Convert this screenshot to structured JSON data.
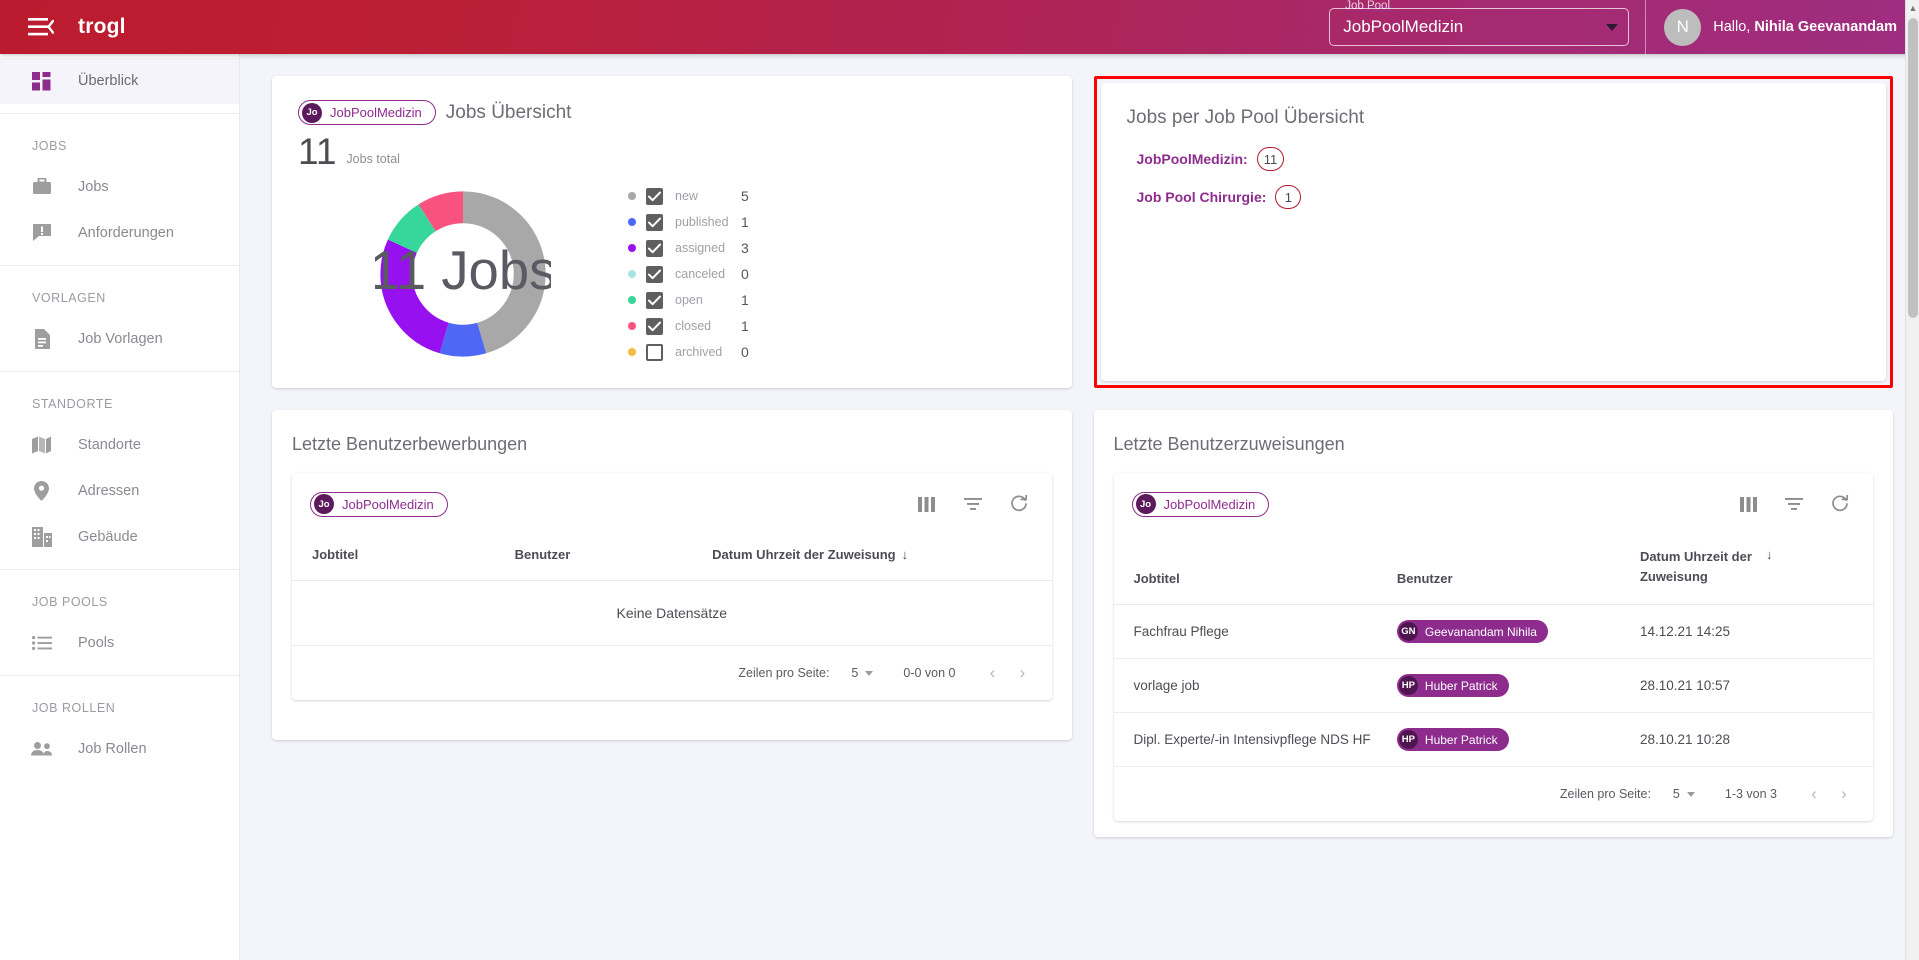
{
  "header": {
    "brand": "trogl",
    "menu_icon": "hamburger-collapse-icon",
    "job_pool_label": "Job Pool",
    "job_pool_value": "JobPoolMedizin",
    "avatar_initial": "N",
    "greeting_prefix": "Hallo, ",
    "user_name": "Nihila Geevanandam"
  },
  "sidebar": {
    "top_item": {
      "label": "Überblick",
      "icon": "dashboard-icon"
    },
    "groups": [
      {
        "title": "JOBS",
        "items": [
          {
            "label": "Jobs",
            "icon": "briefcase-icon"
          },
          {
            "label": "Anforderungen",
            "icon": "announcement-icon"
          }
        ]
      },
      {
        "title": "VORLAGEN",
        "items": [
          {
            "label": "Job Vorlagen",
            "icon": "document-icon"
          }
        ]
      },
      {
        "title": "STANDORTE",
        "items": [
          {
            "label": "Standorte",
            "icon": "map-icon"
          },
          {
            "label": "Adressen",
            "icon": "location-pin-icon"
          },
          {
            "label": "Gebäude",
            "icon": "building-icon"
          }
        ]
      },
      {
        "title": "JOB POOLS",
        "items": [
          {
            "label": "Pools",
            "icon": "list-icon"
          }
        ]
      },
      {
        "title": "JOB ROLLEN",
        "items": [
          {
            "label": "Job Rollen",
            "icon": "people-icon"
          }
        ]
      }
    ]
  },
  "jobs_overview": {
    "chip_avatar": "Jo",
    "chip_label": "JobPoolMedizin",
    "title": "Jobs Übersicht",
    "total_number": "11",
    "total_label": "Jobs total",
    "donut_center": "11 Jobs"
  },
  "chart_data": {
    "type": "pie",
    "title": "Jobs Übersicht",
    "center_label": "11 Jobs",
    "total": 11,
    "categories": [
      "new",
      "published",
      "assigned",
      "canceled",
      "open",
      "closed",
      "archived"
    ],
    "values": [
      5,
      1,
      3,
      0,
      1,
      1,
      0
    ],
    "colors": [
      "#a8a8a8",
      "#4f67f5",
      "#9710f0",
      "#a9e4e4",
      "#37d69a",
      "#f8537f",
      "#f5b942"
    ],
    "checked": [
      true,
      true,
      true,
      true,
      true,
      true,
      false
    ],
    "legend_position": "right",
    "hole": 0.62
  },
  "pool_overview": {
    "title": "Jobs per Job Pool Übersicht",
    "rows": [
      {
        "name": "JobPoolMedizin:",
        "count": "11"
      },
      {
        "name": "Job Pool Chirurgie:",
        "count": "1"
      }
    ]
  },
  "applications_card": {
    "section_title": "Letzte Benutzerbewerbungen",
    "chip_avatar": "Jo",
    "chip_label": "JobPoolMedizin",
    "icons": [
      "columns-icon",
      "filter-icon",
      "refresh-icon"
    ],
    "columns": [
      "Jobtitel",
      "Benutzer",
      "Datum Uhrzeit der Zuweisung"
    ],
    "sort_arrow": "↓",
    "empty_text": "Keine Datensätze",
    "pager": {
      "rows_label": "Zeilen pro Seite:",
      "rows_value": "5",
      "range": "0-0 von 0",
      "prev_icon": "chevron-left-icon",
      "next_icon": "chevron-right-icon"
    }
  },
  "assignments_card": {
    "section_title": "Letzte Benutzerzuweisungen",
    "chip_avatar": "Jo",
    "chip_label": "JobPoolMedizin",
    "icons": [
      "columns-icon",
      "filter-icon",
      "refresh-icon"
    ],
    "columns": [
      "Jobtitel",
      "Benutzer",
      "Datum Uhrzeit der Zuweisung"
    ],
    "sort_arrow": "↓",
    "rows": [
      {
        "job": "Fachfrau Pflege",
        "user_initials": "GN",
        "user": "Geevanandam Nihila",
        "date": "14.12.21 14:25"
      },
      {
        "job": "vorlage job",
        "user_initials": "HP",
        "user": "Huber Patrick",
        "date": "28.10.21 10:57"
      },
      {
        "job": "Dipl. Experte/-in Intensivpflege NDS HF",
        "user_initials": "HP",
        "user": "Huber Patrick",
        "date": "28.10.21 10:28"
      }
    ],
    "pager": {
      "rows_label": "Zeilen pro Seite:",
      "rows_value": "5",
      "range": "1-3 von 3",
      "prev_icon": "chevron-left-icon",
      "next_icon": "chevron-right-icon"
    }
  },
  "colors": {
    "brand_start": "#bb1b2e",
    "brand_end": "#9f2d80",
    "accent_purple": "#8e2c8e",
    "highlight_box": "#ff0000"
  }
}
